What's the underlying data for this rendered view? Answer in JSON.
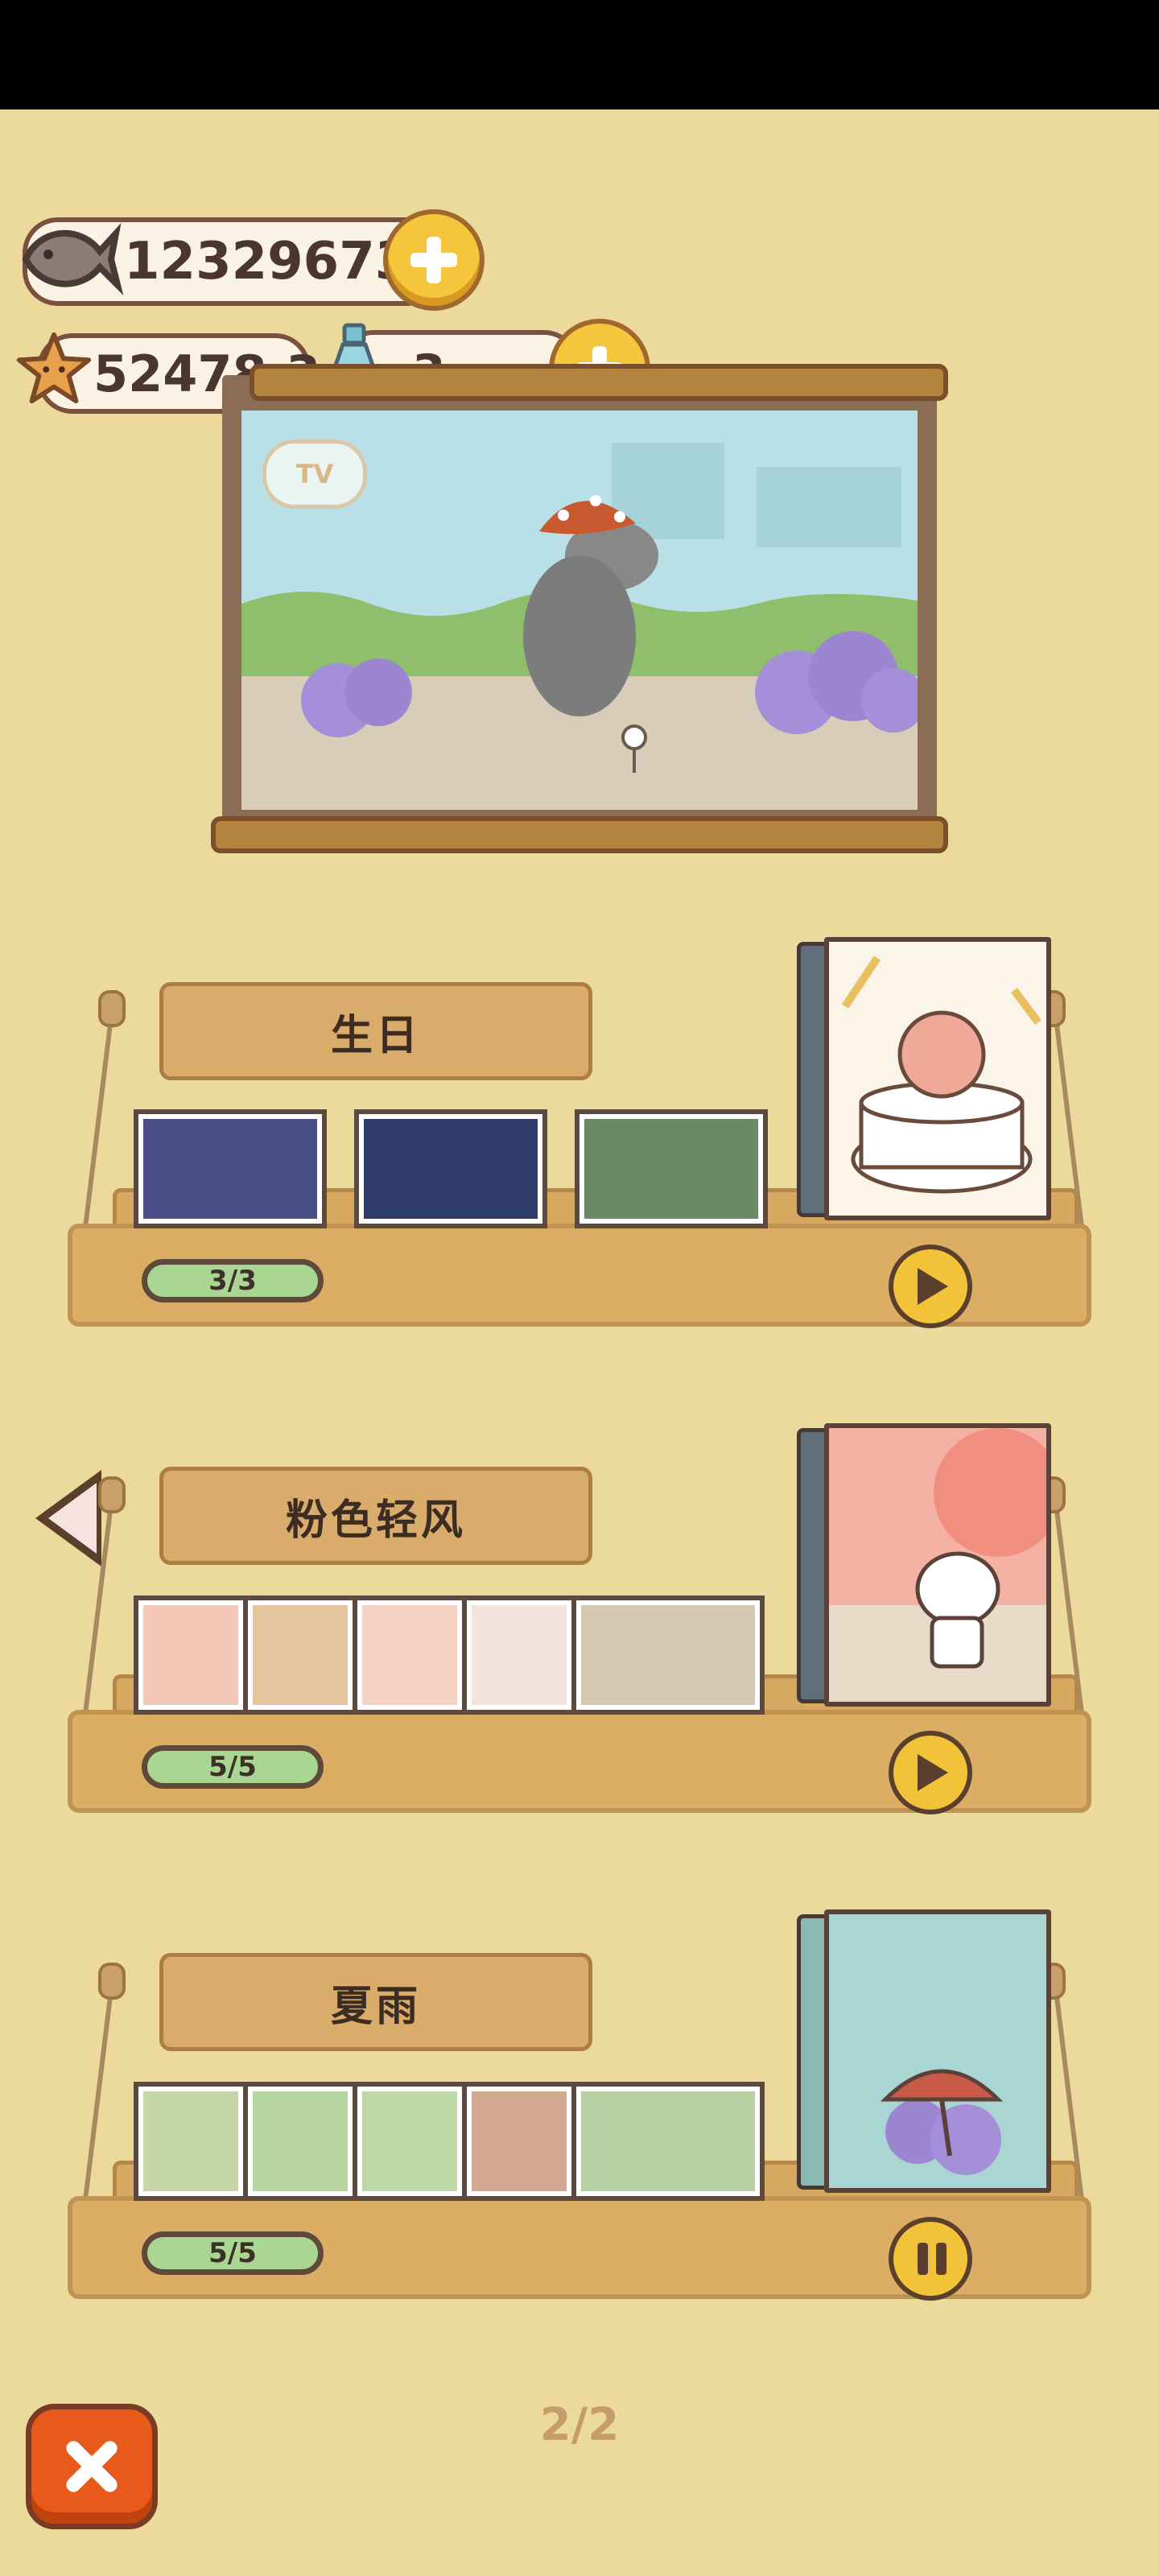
{
  "currency": {
    "fish": "12329673",
    "stars": "52478.3",
    "bottles": "3"
  },
  "albums": [
    {
      "title": "生日",
      "progress": "3/3",
      "state": "play"
    },
    {
      "title": "粉色轻风",
      "progress": "5/5",
      "state": "play"
    },
    {
      "title": "夏雨",
      "progress": "5/5",
      "state": "pause"
    }
  ],
  "tv": {
    "logo": "TV"
  },
  "pager": "2/2",
  "icons": [
    "fish-icon",
    "star-icon",
    "bottle-icon",
    "plus-icon",
    "play-icon",
    "pause-icon",
    "close-icon",
    "back-arrow-icon"
  ],
  "colors": {
    "background": "#ecd99c",
    "accent": "#f2c239",
    "close": "#e85a1c",
    "progress": "#a9d692"
  }
}
